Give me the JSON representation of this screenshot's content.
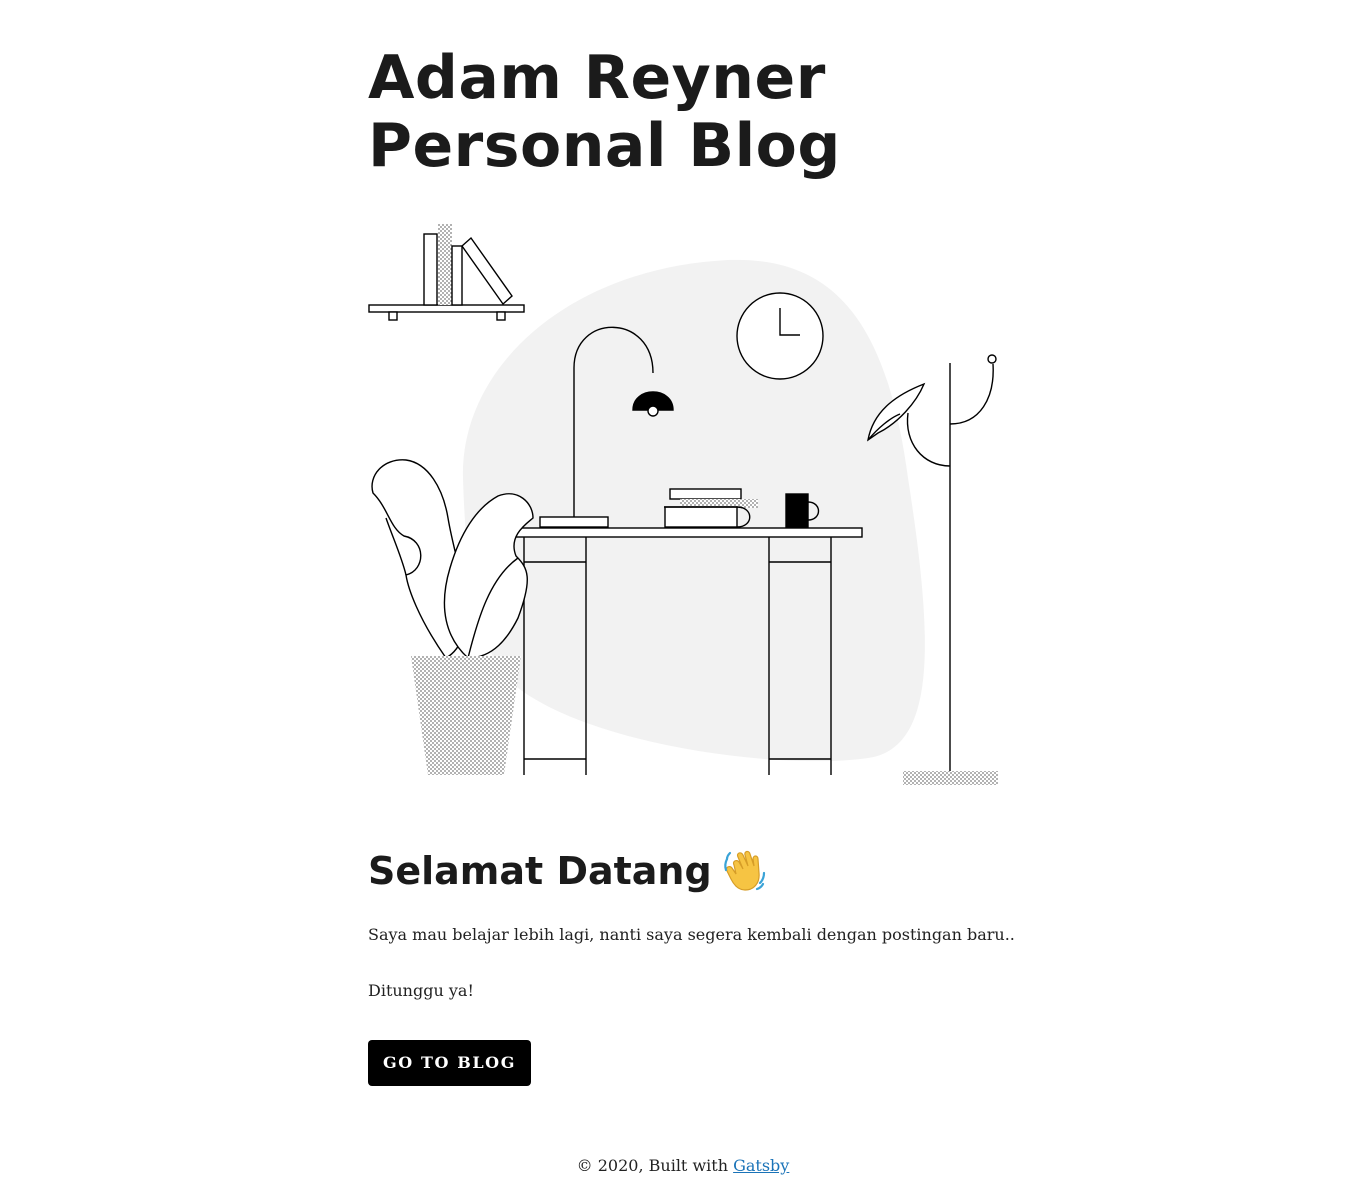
{
  "header": {
    "title_line1": "Adam Reyner",
    "title_line2": "Personal Blog"
  },
  "hero": {
    "illustration": "workspace-desk-illustration"
  },
  "main": {
    "heading": "Selamat Datang",
    "heading_icon": "waving-hand-icon",
    "paragraph1": "Saya mau belajar lebih lagi, nanti saya segera kembali dengan postingan baru..",
    "paragraph2": "Ditunggu ya!",
    "button_label": "GO TO BLOG"
  },
  "footer": {
    "prefix": "© 2020, Built with",
    "link_label": "Gatsby"
  },
  "colors": {
    "text": "#1b1b1b",
    "button_bg": "#000000",
    "button_text": "#ffffff",
    "link": "#1a73b8",
    "blob": "#f2f2f2"
  }
}
